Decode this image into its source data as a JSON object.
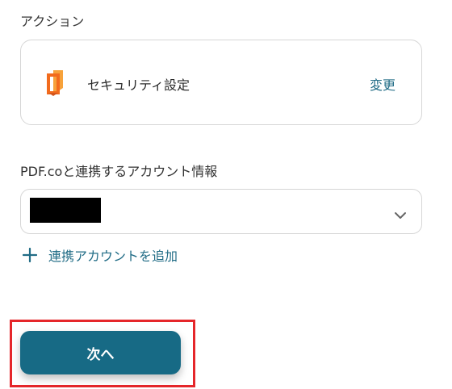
{
  "action_section": {
    "label": "アクション",
    "card": {
      "icon": "pdfco-logo-icon",
      "name": "セキュリティ設定",
      "change_label": "変更"
    }
  },
  "account_section": {
    "label": "PDF.coと連携するアカウント情報",
    "selected_value": "",
    "add_account_label": "連携アカウントを追加"
  },
  "next_button": {
    "label": "次へ"
  },
  "colors": {
    "accent": "#216c86",
    "button": "#176a85",
    "highlight": "#e5262a",
    "logo_orange": "#f26b1d"
  }
}
